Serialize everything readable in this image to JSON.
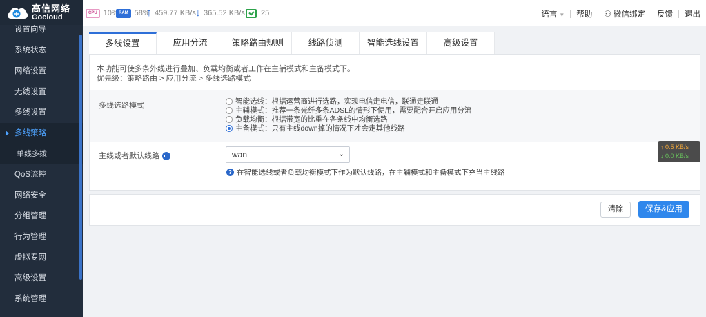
{
  "brand": {
    "name_cn": "高信网络",
    "name_en": "Gocloud"
  },
  "sidebar": {
    "items": [
      {
        "label": "设置向导"
      },
      {
        "label": "系统状态"
      },
      {
        "label": "网络设置"
      },
      {
        "label": "无线设置"
      },
      {
        "label": "多线设置"
      },
      {
        "label": "多线策略",
        "active": true
      },
      {
        "label": "单线多拨",
        "sub": true
      },
      {
        "label": "QoS流控"
      },
      {
        "label": "网络安全"
      },
      {
        "label": "分组管理"
      },
      {
        "label": "行为管理"
      },
      {
        "label": "虚拟专网"
      },
      {
        "label": "高级设置"
      },
      {
        "label": "系统管理"
      }
    ]
  },
  "status": {
    "cpu_chip": "CPU",
    "cpu": "10%",
    "ram_chip": "RAM",
    "ram": "58%",
    "upload": "459.77 KB/s",
    "download": "365.52 KB/s",
    "devices": "25"
  },
  "toplinks": {
    "language": "语言",
    "help": "帮助",
    "wechat": "微信绑定",
    "feedback": "反馈",
    "logout": "退出"
  },
  "tabs": [
    {
      "label": "多线设置",
      "active": true
    },
    {
      "label": "应用分流"
    },
    {
      "label": "策略路由规则"
    },
    {
      "label": "线路侦测"
    },
    {
      "label": "智能选线设置"
    },
    {
      "label": "高级设置"
    }
  ],
  "panel": {
    "desc_line1": "本功能可使多条外线进行叠加、负载均衡或者工作在主辅模式和主备模式下。",
    "desc_line2": "优先级：策略路由 > 应用分流 > 多线选路模式",
    "mode_label": "多线选路模式",
    "modes": [
      {
        "label": "智能选线：根据运营商进行选路，实现电信走电信，联通走联通",
        "checked": false
      },
      {
        "label": "主辅模式：推荐一条光纤多条ADSL的情形下使用，需要配合开启应用分流",
        "checked": false
      },
      {
        "label": "负载均衡：根据带宽的比重在各条线中均衡选路",
        "checked": false
      },
      {
        "label": "主备模式：只有主线down掉的情况下才会走其他线路",
        "checked": true
      }
    ],
    "default_line_label": "主线或者默认线路",
    "default_line_value": "wan",
    "hint": "在智能选线或者负载均衡模式下作为默认线路，在主辅模式和主备模式下充当主线路"
  },
  "speed_overlay": {
    "up": "↑ 0.5 KB/s",
    "down": "↓ 0.0 KB/s"
  },
  "buttons": {
    "clear": "清除",
    "save": "保存&应用"
  },
  "colors": {
    "sidebar": "#222d3c",
    "accent": "#2f87ec",
    "active_menu": "#4ea3ff"
  }
}
